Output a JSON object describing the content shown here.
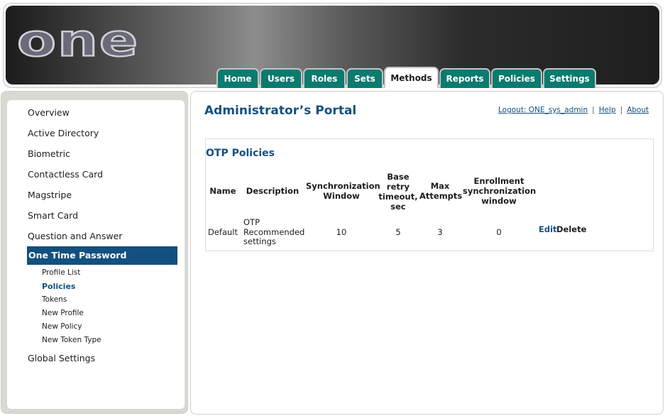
{
  "logo": {
    "text": "one"
  },
  "tabs": [
    {
      "label": "Home",
      "active": false
    },
    {
      "label": "Users",
      "active": false
    },
    {
      "label": "Roles",
      "active": false
    },
    {
      "label": "Sets",
      "active": false
    },
    {
      "label": "Methods",
      "active": true
    },
    {
      "label": "Reports",
      "active": false
    },
    {
      "label": "Policies",
      "active": false
    },
    {
      "label": "Settings",
      "active": false
    }
  ],
  "sidebar": {
    "items": [
      "Overview",
      "Active Directory",
      "Biometric",
      "Contactless Card",
      "Magstripe",
      "Smart Card",
      "Question and Answer",
      "One Time Password"
    ],
    "active_item": "One Time Password",
    "subitems": [
      {
        "label": "Profile List",
        "active": false
      },
      {
        "label": "Policies",
        "active": true
      },
      {
        "label": "Tokens",
        "active": false
      },
      {
        "label": "New Profile",
        "active": false
      },
      {
        "label": "New Policy",
        "active": false
      },
      {
        "label": "New Token Type",
        "active": false
      }
    ],
    "after_item": "Global Settings"
  },
  "main": {
    "title": "Administrator’s Portal",
    "links": {
      "logout": "Logout: ONE_sys_admin",
      "help": "Help",
      "about": "About",
      "separator": "|"
    },
    "panel_title": "OTP Policies",
    "columns": {
      "name": "Name",
      "description": "Description",
      "sync_window_1": "Synchronization",
      "sync_window_2": "Window",
      "base_retry_1": "Base",
      "base_retry_2": "retry",
      "base_retry_3": "timeout,",
      "base_retry_4": "sec",
      "max_attempts_1": "Max",
      "max_attempts_2": "Attempts",
      "enroll_1": "Enrollment",
      "enroll_2": "synchronization",
      "enroll_3": "window"
    },
    "row": {
      "name": "Default",
      "description_1": "OTP",
      "description_2": "Recommended",
      "description_3": "settings",
      "sync_window": "10",
      "base_retry": "5",
      "max_attempts": "3",
      "enrollment_window": "0",
      "edit": "Edit",
      "delete": "Delete"
    }
  },
  "colors": {
    "tab": "#0a7b6f",
    "accent": "#13507f",
    "text": "#1d1d1d"
  }
}
